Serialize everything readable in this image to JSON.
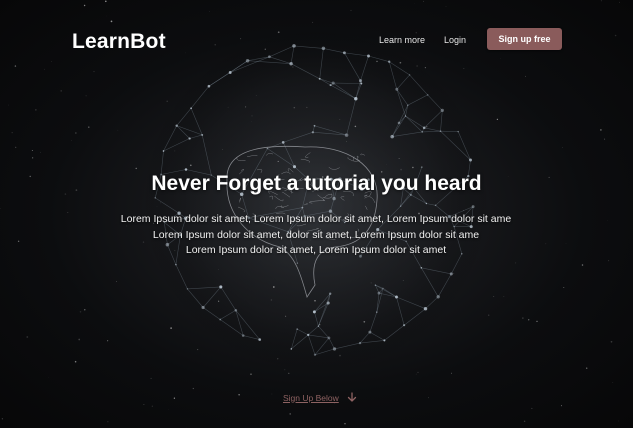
{
  "brand": {
    "name": "LearnBot"
  },
  "nav": {
    "learn_more": "Learn more",
    "login": "Login",
    "signup": "Sign up free"
  },
  "hero": {
    "title": "Never Forget a tutorial you heard",
    "lines": [
      "Lorem Ipsum dolor sit amet, Lorem Ipsum dolor sit amet, Lorem Ipsum dolor sit ame",
      "Lorem Ipsum dolor sit amet, dolor sit amet, Lorem Ipsum dolor sit ame",
      "Lorem Ipsum dolor sit amet, Lorem Ipsum dolor sit amet"
    ]
  },
  "cta": {
    "label": "Sign Up Below",
    "icon": "arrow-down-icon"
  },
  "background": {
    "icon": "brain-network-globe-icon"
  },
  "colors": {
    "accent": "#8a5b5b",
    "cta_text": "#8e6262",
    "background": "#0d0d0f"
  }
}
